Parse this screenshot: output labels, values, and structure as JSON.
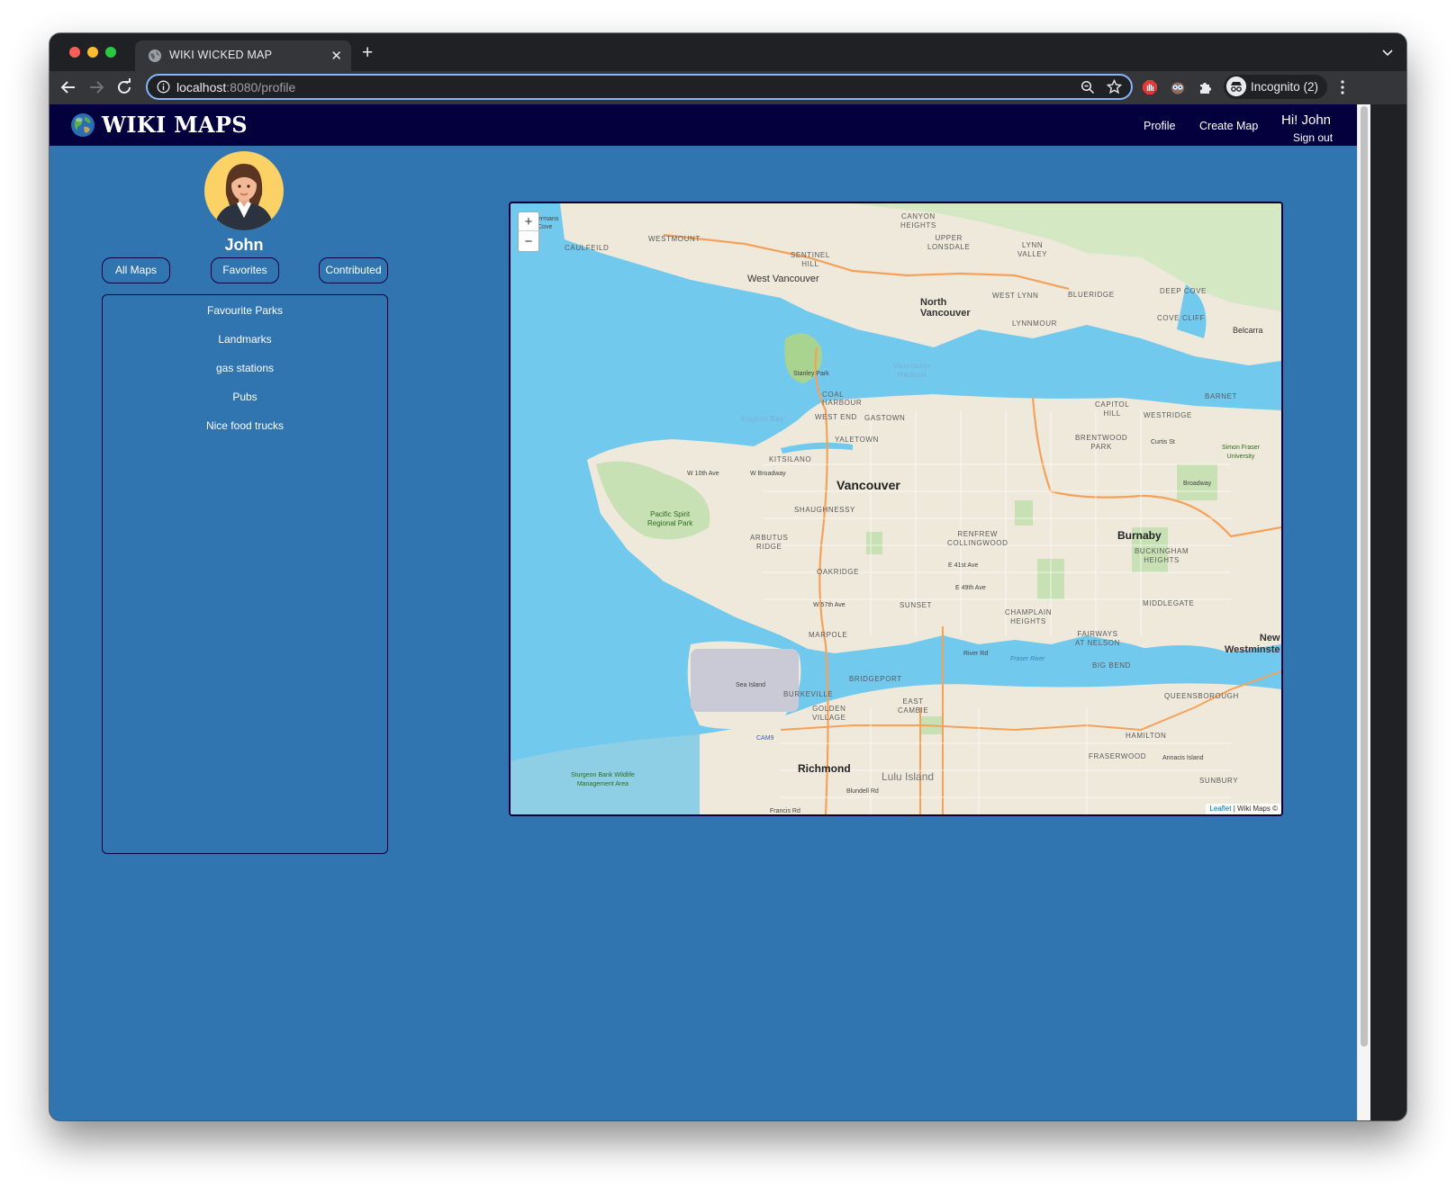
{
  "browser": {
    "tab_title": "WIKI WICKED MAP",
    "url_host": "localhost",
    "url_rest": ":8080/profile",
    "incognito_label": "Incognito (2)"
  },
  "nav": {
    "brand": "WIKI MAPS",
    "profile_link": "Profile",
    "create_map_link": "Create Map",
    "greeting": "Hi! John",
    "sign_out": "Sign out"
  },
  "profile": {
    "username": "John",
    "tabs": [
      "All Maps",
      "Favorites",
      "Contributed"
    ]
  },
  "map_list": [
    "Favourite Parks",
    "Landmarks",
    "gas stations",
    "Pubs",
    "Nice food trucks"
  ],
  "map": {
    "zoom_in": "+",
    "zoom_out": "−",
    "attribution_link": "Leaflet",
    "attribution_text": " | Wiki Maps ©",
    "labels": {
      "vancouver": "Vancouver",
      "north_vancouver": "North\nVancouver",
      "west_vancouver": "West Vancouver",
      "burnaby": "Burnaby",
      "richmond": "Richmond",
      "new_westminster": "New\nWestminste",
      "lulu_island": "Lulu Island",
      "belcarra": "Belcarra",
      "sea_island": "Sea Island",
      "stanley_park": "Stanley Park",
      "pacific_spirit": "Pacific Spirit\nRegional Park",
      "sturgeon_bank": "Sturgeon Bank Wildlife\nManagement Area",
      "sfu": "Simon Fraser\nUniversity",
      "kitsilano": "KITSILANO",
      "shaughnessy": "SHAUGHNESSY",
      "gastown": "GASTOWN",
      "yaletown": "YALETOWN",
      "west_end": "WEST END",
      "coal_harbour": "COAL\nHARBOUR",
      "arbutus_ridge": "ARBUTUS\nRIDGE",
      "oakridge": "OAKRIDGE",
      "marpole": "MARPOLE",
      "sunset": "SUNSET",
      "renfrew": "RENFREW\nCOLLINGWOOD",
      "capitol_hill": "CAPITOL\nHILL",
      "westridge": "WESTRIDGE",
      "brentwood": "BRENTWOOD\nPARK",
      "champlain": "CHAMPLAIN\nHEIGHTS",
      "middlegate": "MIDDLEGATE",
      "buckingham": "BUCKINGHAM\nHEIGHTS",
      "fairways": "FAIRWAYS\nAT NELSON",
      "big_bend": "BIG BEND",
      "queensborough": "QUEENSBOROUGH",
      "hamilton": "HAMILTON",
      "fraserwood": "FRASERWOOD",
      "bridgeport": "BRIDGEPORT",
      "burkeville": "BURKEVILLE",
      "golden_village": "GOLDEN\nVILLAGE",
      "east_cambie": "EAST\nCAMBIE",
      "canyon_heights": "CANYON\nHEIGHTS",
      "upper_lonsdale": "UPPER\nLONSDALE",
      "lynn_valley": "LYNN\nVALLEY",
      "sentinel_hill": "SENTINEL\nHILL",
      "westmount": "WESTMOUNT",
      "caulfeild": "CAULFEILD",
      "west_lynn": "WEST LYNN",
      "lynnmour": "LYNNMOUR",
      "blueridge": "BLUERIDGE",
      "deep_cove": "DEEP COVE",
      "cove_cliff": "COVE CLIFF",
      "barnet": "BARNET",
      "whytecliff": "ermans\nCove",
      "english_bay": "English Bay",
      "vancouver_harbour": "Vancouver\nHarbour",
      "fraser_river": "Fraser River",
      "w10th": "W 10th Ave",
      "wbroadway": "W Broadway",
      "w57th": "W 57th Ave",
      "e41st": "E 41st Ave",
      "e49th": "E 49th Ave",
      "curtis": "Curtis St",
      "broadway": "Broadway",
      "river_rd": "River Rd",
      "blundell": "Blundell Rd",
      "francis": "Francis Rd",
      "annacis": "Annacis Island",
      "sunbury": "SUNBURY",
      "cam": "CAM9"
    }
  }
}
